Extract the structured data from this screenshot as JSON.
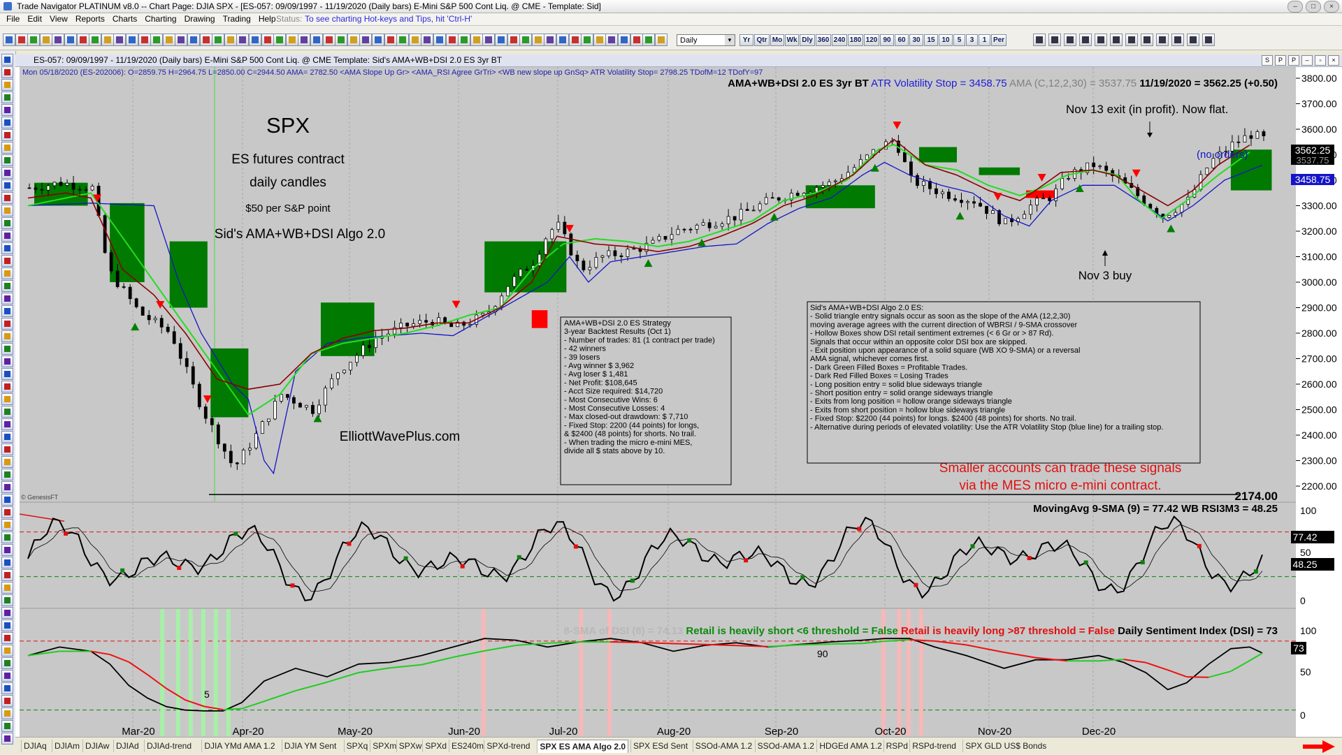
{
  "window": {
    "title": "Trade Navigator PLATINUM v8.0  -- Chart Page: DJIA SPX - [ES-057: 09/09/1997 - 11/19/2020 (Daily bars)  E-Mini S&P 500 Cont Liq. @ CME  - Template: Sid]"
  },
  "menu": {
    "items": [
      "File",
      "Edit",
      "View",
      "Reports",
      "Charts",
      "Charting",
      "Drawing",
      "Trading",
      "Help"
    ],
    "status_label": "Status:",
    "status_text": "To see charting Hot-keys and Tips, hit 'Ctrl-H'"
  },
  "toolbar": {
    "interval": "Daily",
    "periods": [
      "Yr",
      "Qtr",
      "Mo",
      "Wk",
      "Dly",
      "360",
      "240",
      "180",
      "120",
      "90",
      "60",
      "30",
      "15",
      "10",
      "5",
      "3",
      "1",
      "Per"
    ]
  },
  "chart_header": {
    "title": "ES-057:  09/09/1997 - 11/19/2020  (Daily bars)    E-Mini S&P 500 Cont Liq. @ CME    Template: Sid's AMA+WB+DSI 2.0 ES 3yr BT",
    "buttons": [
      "S",
      "P",
      "P"
    ]
  },
  "price_pane": {
    "bar_info": [
      {
        "text": "Mon",
        "color": "#2020b0"
      },
      {
        "text": "05/18/2020 (ES-202006):",
        "color": "#2020b0"
      },
      {
        "text": "O=2859.75",
        "color": "#2020b0"
      },
      {
        "text": "H=2964.75",
        "color": "#2020b0"
      },
      {
        "text": "L=2850.00",
        "color": "#2020b0"
      },
      {
        "text": "C=2944.50",
        "color": "#2020b0"
      },
      {
        "text": "AMA= 2782.50",
        "color": "#2020b0"
      },
      {
        "text": "<AMA Slope Up Gr>",
        "color": "#2020b0"
      },
      {
        "text": "<AMA_RSI Agree GrTri>",
        "color": "#2020b0"
      },
      {
        "text": "<WB new slope up GnSq>",
        "color": "#2020b0"
      },
      {
        "text": "ATR Volatility Stop= 2798.25",
        "color": "#2020b0"
      },
      {
        "text": "TDofM=12",
        "color": "#2020b0"
      },
      {
        "text": "TDofY=97",
        "color": "#2020b0"
      }
    ],
    "legend": [
      {
        "text": "AMA+WB+DSI 2.0 ES 3yr BT",
        "color": "#000000"
      },
      {
        "text": "ATR Volatility Stop = 3458.75",
        "color": "#1c1cd8"
      },
      {
        "text": "AMA (C,12,2,30) = 3537.75",
        "color": "#808080"
      },
      {
        "text": "11/19/2020 = 3562.25 (+0.50)",
        "color": "#000000"
      }
    ],
    "current_price_label": "3562.25",
    "ama_label": "3537.75",
    "stop_label": "3458.75",
    "low_label": "2174.00",
    "no_orders": "(no orders)",
    "copyright": "© GenesisFT",
    "y_ticks": [
      "3800.00",
      "3700.00",
      "3600.00",
      "3500.00",
      "3400.00",
      "3300.00",
      "3200.00",
      "3100.00",
      "3000.00",
      "2900.00",
      "2800.00",
      "2700.00",
      "2600.00",
      "2500.00",
      "2400.00",
      "2300.00",
      "2200.00"
    ],
    "annotations": {
      "spx": "SPX",
      "line1": "ES futures contract",
      "line2": "daily candles",
      "line3": "$50 per S&P point",
      "line4": "Sid's AMA+WB+DSI Algo 2.0",
      "website": "ElliottWavePlus.com",
      "nov13": "Nov 13 exit (in profit). Now flat.",
      "nov3": "Nov 3 buy",
      "smaller1": "Smaller accounts can trade these signals",
      "smaller2": "via the MES micro e-mini contract."
    },
    "backtest_box": [
      "AMA+WB+DSI 2.0 ES Strategy",
      "3-year Backtest Results (Oct 1)",
      "- Number of trades: 81 (1 contract per trade)",
      "- 42 winners",
      "- 39 losers",
      "- Avg winner $ 3,962",
      "- Avg loser $ 1,481",
      "- Net Profit: $108,645",
      "- Acct Size required: $14,720",
      "- Most Consecutive Wins: 6",
      "- Most Consecutive Losses: 4",
      "- Max closed-out drawdown: $ 7,710",
      "- Fixed Stop: 2200 (44 points) for longs,",
      "& $2400 (48 points) for shorts.  No trail.",
      "- When trading the micro e-mini MES,",
      "divide all $ stats above by 10."
    ],
    "rules_box": [
      "Sid's AMA+WB+DSI Algo 2.0 ES:",
      "- Solid triangle entry signals occur as soon as the slope of the AMA (12,2,30)",
      "moving average agrees with the current direction of WBRSI / 9-SMA crossover",
      "- Hollow Boxes show DSI retail sentiment extremes (< 6 Gr or > 87 Rd).",
      "Signals that occur within an opposite color DSI box are skipped.",
      "- Exit position upon appearance of a solid square (WB XO 9-SMA) or a reversal",
      "AMA signal, whichever comes first.",
      "- Dark Green Filled Boxes = Profitable Trades.",
      "- Dark Red Filled Boxes = Losing Trades",
      "- Long position entry = solid blue sideways triangle",
      "- Short position entry = solid orange sideways triangle",
      "- Exits from long position = hollow orange sideways triangle",
      "- Exits from short position = hollow blue sideways triangle",
      "- Fixed Stop: $2200 (44 points) for longs. $2400 (48 points) for shorts. No trail.",
      "- Alternative during periods of elevated volatility: Use the ATR Volatility Stop (blue line) for a trailing stop."
    ]
  },
  "wb_pane": {
    "legend": "MovingAvg 9-SMA (9) = 77.42   WB RSI3M3 = 48.25",
    "y_ticks": [
      "100",
      "50",
      "0"
    ],
    "label_upper": "77.42",
    "label_lower": "48.25"
  },
  "dsi_pane": {
    "legend": [
      {
        "text": "8-SMA of DSI (8) = 74.13",
        "color": "#b8b8b8"
      },
      {
        "text": "Retail is heavily short <6 threshold = False",
        "color": "#0c8a0c"
      },
      {
        "text": "Retail is heavily long >87 threshold = False",
        "color": "#e01010"
      },
      {
        "text": "Daily Sentiment Index (DSI) = 73",
        "color": "#000000"
      }
    ],
    "y_ticks": [
      "100",
      "50",
      "0"
    ],
    "value_label": "73",
    "note_low": "5",
    "note_high": "90"
  },
  "x_axis": [
    "Mar-20",
    "Apr-20",
    "May-20",
    "Jun-20",
    "Jul-20",
    "Aug-20",
    "Sep-20",
    "Oct-20",
    "Nov-20",
    "Dec-20"
  ],
  "tabs": [
    "DJIAq",
    "DJIAm",
    "DJIAw",
    "DJIAd",
    "DJIAd-trend",
    "DJIA YMd AMA 1.2",
    "DJIA YM Sent",
    "SPXq",
    "SPXm",
    "SPXw",
    "SPXd",
    "ES240m",
    "SPXd-trend",
    "SPX ES AMA Algo 2.0",
    "SPX ESd Sent",
    "SSOd-AMA 1.2",
    "SSOd-AMA 1.2",
    "HDGEd AMA 1.2",
    "RSPd",
    "RSPd-trend",
    "SPX GLD US$ Bonds"
  ],
  "active_tab": "SPX ES AMA Algo 2.0",
  "colors": {
    "price": "#000000",
    "ama": "#8b0000",
    "fast": "#22dd22",
    "stop": "#1414c8",
    "profit_box": "#007a00",
    "loss_box": "#ff0000",
    "pane_bg": "#ffffff",
    "gray_pane": "#c0c0c0"
  },
  "chart_data": {
    "type": "line",
    "title": "SPX",
    "x": [
      "Mar-20",
      "Apr-20",
      "May-20",
      "Jun-20",
      "Jul-20",
      "Aug-20",
      "Sep-20",
      "Oct-20",
      "Nov-20",
      "Dec-20"
    ],
    "ylim": [
      2174,
      3800
    ],
    "series": [
      {
        "name": "ES close",
        "values": [
          [
            0,
            3370
          ],
          [
            10,
            3390
          ],
          [
            20,
            3370
          ],
          [
            25,
            3050
          ],
          [
            35,
            2880
          ],
          [
            45,
            2800
          ],
          [
            55,
            2500
          ],
          [
            65,
            2270
          ],
          [
            72,
            2400
          ],
          [
            80,
            2560
          ],
          [
            90,
            2500
          ],
          [
            98,
            2650
          ],
          [
            110,
            2780
          ],
          [
            120,
            2830
          ],
          [
            128,
            2850
          ],
          [
            135,
            2820
          ],
          [
            145,
            2870
          ],
          [
            152,
            2990
          ],
          [
            160,
            3080
          ],
          [
            165,
            3200
          ],
          [
            168,
            3220
          ],
          [
            175,
            3050
          ],
          [
            182,
            3100
          ],
          [
            190,
            3120
          ],
          [
            198,
            3150
          ],
          [
            205,
            3200
          ],
          [
            215,
            3230
          ],
          [
            225,
            3260
          ],
          [
            235,
            3320
          ],
          [
            245,
            3360
          ],
          [
            255,
            3390
          ],
          [
            262,
            3450
          ],
          [
            270,
            3530
          ],
          [
            275,
            3560
          ],
          [
            280,
            3400
          ],
          [
            290,
            3350
          ],
          [
            300,
            3320
          ],
          [
            310,
            3230
          ],
          [
            318,
            3300
          ],
          [
            325,
            3340
          ],
          [
            330,
            3420
          ],
          [
            338,
            3460
          ],
          [
            346,
            3400
          ],
          [
            352,
            3340
          ],
          [
            360,
            3260
          ],
          [
            368,
            3320
          ],
          [
            375,
            3470
          ],
          [
            382,
            3540
          ],
          [
            388,
            3580
          ],
          [
            392,
            3562.25
          ]
        ]
      },
      {
        "name": "AMA (C,12,2,30)",
        "values": [
          [
            0,
            3330
          ],
          [
            12,
            3350
          ],
          [
            20,
            3330
          ],
          [
            30,
            3050
          ],
          [
            40,
            2950
          ],
          [
            50,
            2800
          ],
          [
            60,
            2620
          ],
          [
            70,
            2580
          ],
          [
            80,
            2600
          ],
          [
            90,
            2720
          ],
          [
            100,
            2780
          ],
          [
            110,
            2810
          ],
          [
            120,
            2820
          ],
          [
            130,
            2840
          ],
          [
            140,
            2840
          ],
          [
            150,
            2900
          ],
          [
            160,
            3000
          ],
          [
            168,
            3180
          ],
          [
            180,
            3150
          ],
          [
            190,
            3140
          ],
          [
            200,
            3120
          ],
          [
            210,
            3140
          ],
          [
            220,
            3180
          ],
          [
            230,
            3230
          ],
          [
            240,
            3300
          ],
          [
            250,
            3340
          ],
          [
            262,
            3420
          ],
          [
            270,
            3510
          ],
          [
            275,
            3560
          ],
          [
            285,
            3460
          ],
          [
            295,
            3420
          ],
          [
            305,
            3360
          ],
          [
            315,
            3320
          ],
          [
            320,
            3360
          ],
          [
            328,
            3430
          ],
          [
            338,
            3440
          ],
          [
            345,
            3420
          ],
          [
            355,
            3350
          ],
          [
            362,
            3300
          ],
          [
            370,
            3360
          ],
          [
            378,
            3460
          ],
          [
            388,
            3537.75
          ]
        ]
      },
      {
        "name": "Fast MA",
        "values": [
          [
            0,
            3300
          ],
          [
            20,
            3350
          ],
          [
            70,
            2480
          ],
          [
            80,
            2560
          ],
          [
            90,
            2720
          ],
          [
            100,
            2760
          ],
          [
            110,
            2780
          ],
          [
            120,
            2800
          ],
          [
            130,
            2830
          ],
          [
            140,
            2870
          ],
          [
            150,
            2900
          ],
          [
            160,
            3050
          ],
          [
            170,
            3150
          ],
          [
            180,
            3170
          ],
          [
            190,
            3160
          ],
          [
            200,
            3140
          ],
          [
            210,
            3160
          ],
          [
            220,
            3200
          ],
          [
            230,
            3240
          ],
          [
            240,
            3320
          ],
          [
            250,
            3350
          ],
          [
            260,
            3400
          ],
          [
            270,
            3520
          ],
          [
            275,
            3540
          ],
          [
            285,
            3460
          ],
          [
            295,
            3440
          ],
          [
            305,
            3380
          ],
          [
            315,
            3340
          ],
          [
            322,
            3370
          ],
          [
            330,
            3420
          ],
          [
            338,
            3440
          ],
          [
            346,
            3420
          ],
          [
            352,
            3330
          ],
          [
            360,
            3250
          ],
          [
            368,
            3320
          ],
          [
            378,
            3420
          ],
          [
            388,
            3510
          ]
        ]
      },
      {
        "name": "ATR Volatility Stop",
        "values": [
          [
            0,
            3300
          ],
          [
            20,
            3310
          ],
          [
            40,
            3300
          ],
          [
            48,
            3000
          ],
          [
            55,
            2800
          ],
          [
            65,
            2600
          ],
          [
            70,
            2540
          ],
          [
            75,
            2300
          ],
          [
            78,
            2250
          ],
          [
            85,
            2650
          ],
          [
            95,
            2760
          ],
          [
            105,
            2780
          ],
          [
            115,
            2790
          ],
          [
            125,
            2800
          ],
          [
            135,
            2790
          ],
          [
            145,
            2860
          ],
          [
            155,
            2930
          ],
          [
            165,
            3000
          ],
          [
            172,
            3100
          ],
          [
            178,
            3000
          ],
          [
            185,
            3080
          ],
          [
            195,
            3100
          ],
          [
            205,
            3120
          ],
          [
            215,
            3140
          ],
          [
            225,
            3150
          ],
          [
            235,
            3230
          ],
          [
            245,
            3290
          ],
          [
            255,
            3330
          ],
          [
            265,
            3420
          ],
          [
            272,
            3470
          ],
          [
            280,
            3420
          ],
          [
            290,
            3380
          ],
          [
            300,
            3350
          ],
          [
            310,
            3260
          ],
          [
            318,
            3220
          ],
          [
            325,
            3320
          ],
          [
            335,
            3380
          ],
          [
            345,
            3380
          ],
          [
            355,
            3300
          ],
          [
            362,
            3240
          ],
          [
            370,
            3300
          ],
          [
            380,
            3400
          ],
          [
            392,
            3458.75
          ]
        ]
      }
    ]
  }
}
